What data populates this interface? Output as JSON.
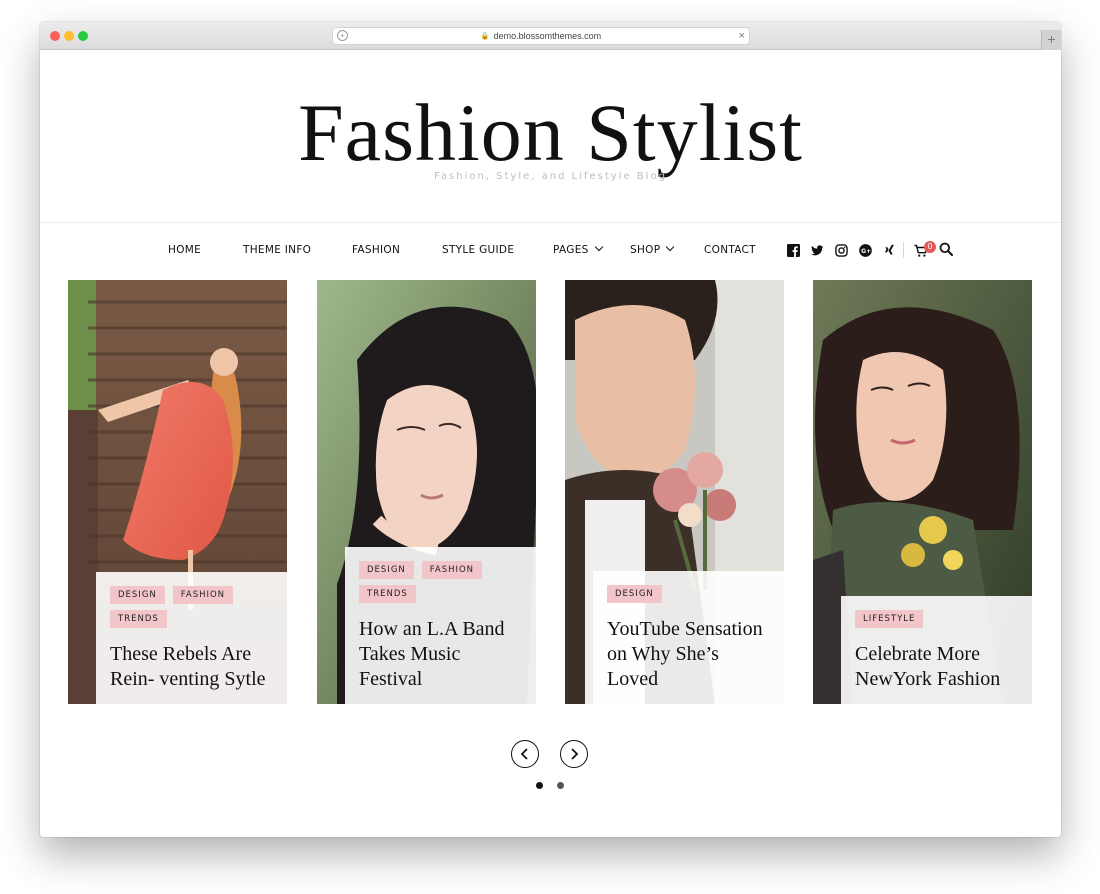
{
  "browser": {
    "url": "demo.blossomthemes.com",
    "new_tab": "+",
    "close": "×"
  },
  "site": {
    "title": "Fashion Stylist",
    "tagline": "Fashion, Style, and Lifestyle Blog"
  },
  "nav": {
    "items": [
      "HOME",
      "THEME INFO",
      "FASHION",
      "STYLE GUIDE",
      "PAGES",
      "SHOP",
      "CONTACT"
    ],
    "social_icons": [
      "facebook-icon",
      "twitter-icon",
      "instagram-icon",
      "google-plus-icon",
      "xing-icon"
    ],
    "cart_count": "0"
  },
  "slides": [
    {
      "tags": [
        "DESIGN",
        "FASHION",
        "TRENDS"
      ],
      "title": "These Rebels Are Rein- venting Sytle"
    },
    {
      "tags": [
        "DESIGN",
        "FASHION",
        "TRENDS"
      ],
      "title": "How an L.A Band Takes Music Festival"
    },
    {
      "tags": [
        "DESIGN"
      ],
      "title": "YouTube Sensation on Why She’s Loved"
    },
    {
      "tags": [
        "LIFESTYLE"
      ],
      "title": "Celebrate More NewYork Fashion"
    }
  ],
  "pagination": {
    "pages": 2,
    "current": 1
  },
  "colors": {
    "tag_bg": "#f2c6c9",
    "cart_badge": "#e35a5a",
    "text": "#111111"
  }
}
